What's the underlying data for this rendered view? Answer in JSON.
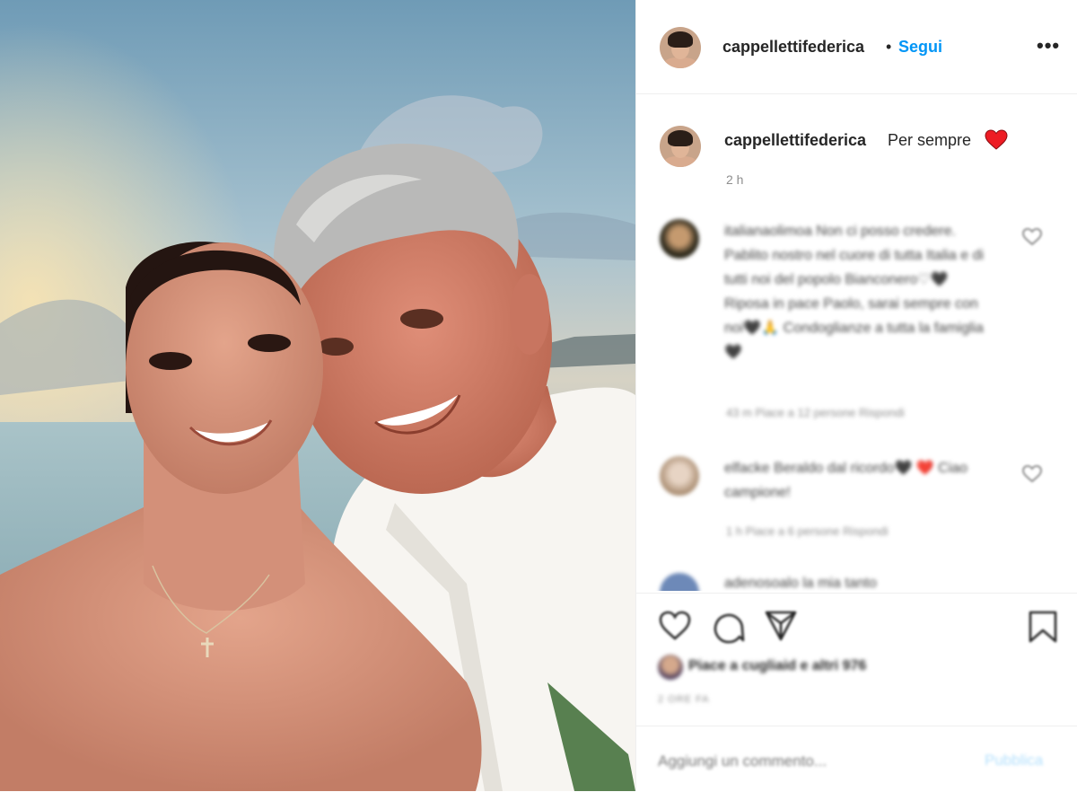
{
  "header": {
    "username": "cappellettifederica",
    "separator": "•",
    "follow_label": "Segui",
    "more_label": "•••"
  },
  "caption": {
    "username": "cappellettifederica",
    "text": "Per sempre",
    "emoji_icon": "red-heart-icon",
    "time": "2 h"
  },
  "comments": [
    {
      "text": "italianaolimoa Non ci posso credere. Pablito nostro nel cuore di tutta Italia e di tutti noi del popolo Bianconero♡🖤 Riposa in pace Paolo, sarai sempre con noi🖤🙏 Condoglianze a tutta la famiglia🖤",
      "meta": "43 m   Piace a 12 persone   Rispondi"
    },
    {
      "text": "elfacke Beraldo dal ricordo🖤 ❤️ Ciao campione!",
      "meta": "1 h   Piace a 6 persone   Rispondi"
    },
    {
      "text": "adenosoalo la mia tanto",
      "meta": ""
    }
  ],
  "likes": {
    "text": "Piace a cugliaid e altri 976",
    "date": "2 ORE FA"
  },
  "add_comment": {
    "placeholder": "Aggiungi un commento...",
    "publish_label": "Pubblica"
  },
  "colors": {
    "follow": "#0095f6",
    "heart": "#ed1c24",
    "text": "#262626",
    "muted": "#8e8e8e"
  }
}
